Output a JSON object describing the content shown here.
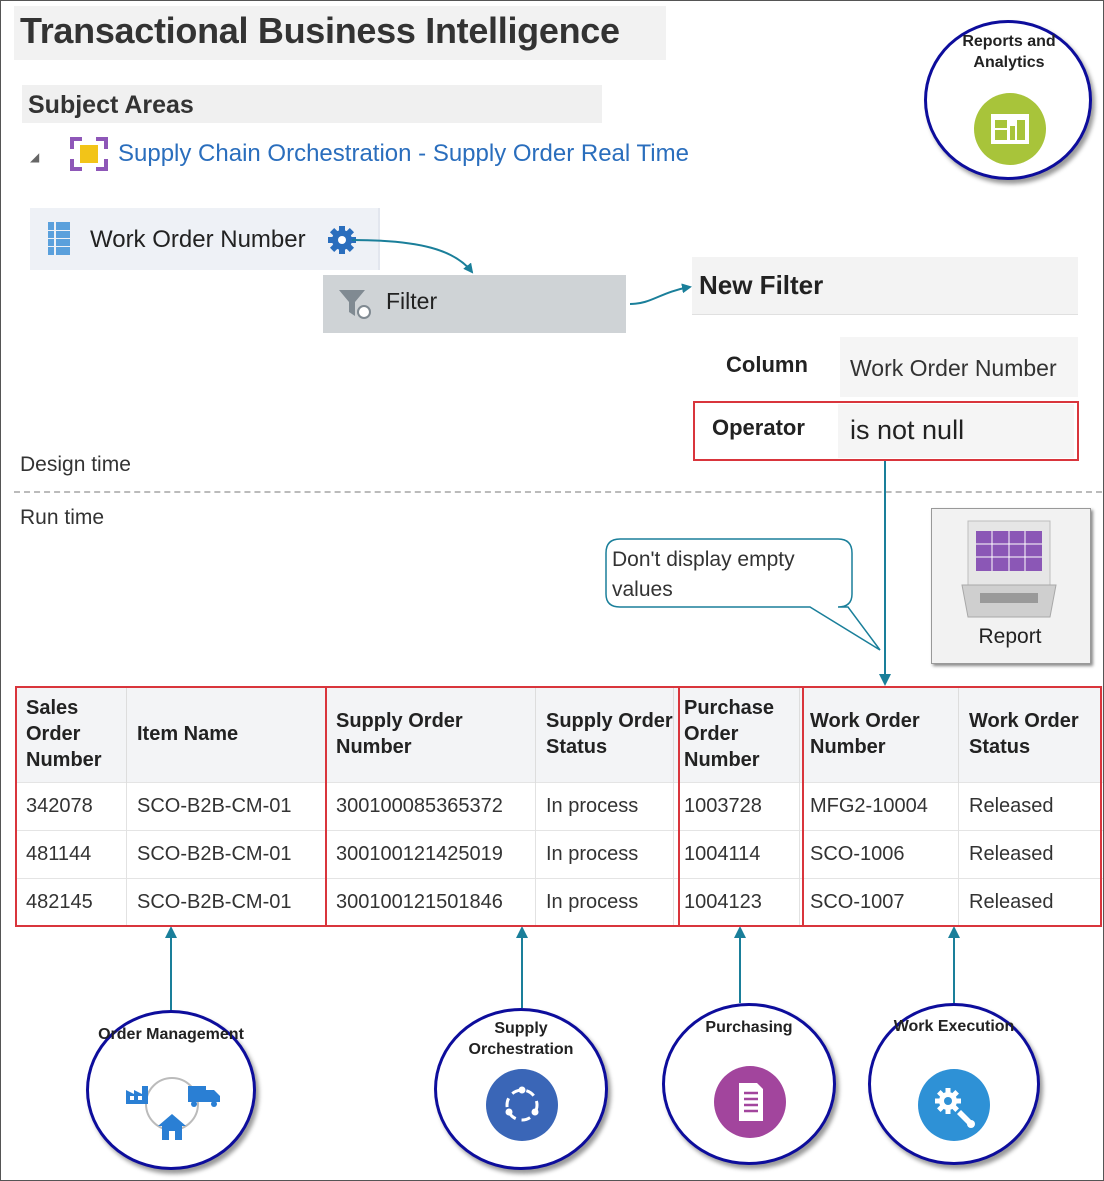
{
  "title": "Transactional Business Intelligence",
  "subject_areas": {
    "heading": "Subject Areas",
    "link": "Supply Chain Orchestration - Supply Order Real Time"
  },
  "column_chip": {
    "label": "Work Order Number"
  },
  "filter_button": {
    "label": "Filter"
  },
  "new_filter": {
    "title": "New Filter",
    "column_label": "Column",
    "column_value": "Work Order Number",
    "operator_label": "Operator",
    "operator_value": "is not null"
  },
  "phases": {
    "design": "Design time",
    "run": "Run time"
  },
  "callout": "Don't display empty values",
  "report": {
    "label": "Report"
  },
  "reports_analytics": {
    "label": "Reports and Analytics"
  },
  "table": {
    "headers": [
      "Sales Order Number",
      "Item Name",
      "Supply Order Number",
      "Supply Order Status",
      "Purchase Order Number",
      "Work Order Number",
      "Work Order Status"
    ],
    "rows": [
      [
        "342078",
        "SCO-B2B-CM-01",
        "300100085365372",
        "In process",
        "1003728",
        "MFG2-10004",
        "Released"
      ],
      [
        "481144",
        "SCO-B2B-CM-01",
        "300100121425019",
        "In process",
        "1004114",
        "SCO-1006",
        "Released"
      ],
      [
        "482145",
        "SCO-B2B-CM-01",
        "300100121501846",
        "In process",
        "1004123",
        "SCO-1007",
        "Released"
      ]
    ]
  },
  "modules": [
    {
      "label": "Order Management",
      "icon": "factory-truck-house-icon",
      "color": "#2a7fd4"
    },
    {
      "label": "Supply Orchestration",
      "icon": "orchestration-cycle-icon",
      "color": "#3a66b7"
    },
    {
      "label": "Purchasing",
      "icon": "document-icon",
      "color": "#a2459d"
    },
    {
      "label": "Work Execution",
      "icon": "gear-wrench-icon",
      "color": "#2e91d6"
    }
  ],
  "colors": {
    "highlight": "#d9353c",
    "connector": "#1a7f9a",
    "circle_border": "#0d0d9c",
    "link": "#2a6ebd"
  }
}
